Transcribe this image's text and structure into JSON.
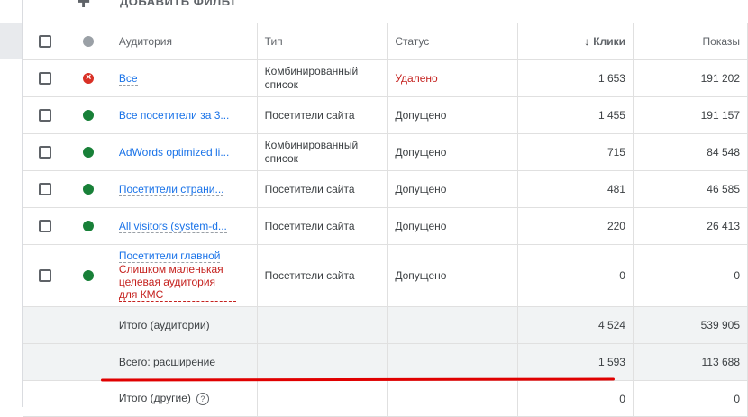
{
  "toolbar": {
    "add_icon": "plus-icon",
    "add_label": "ДОБАВИТЬ ФИЛЬТ"
  },
  "table": {
    "headers": {
      "audience": "Аудитория",
      "type": "Тип",
      "status": "Статус",
      "clicks": "Клики",
      "impressions": "Показы"
    },
    "rows": [
      {
        "status_dot": "red",
        "audience": "Все",
        "audience_note": "",
        "type": "Комбинированный список",
        "status": "Удалено",
        "clicks": "1 653",
        "impressions": "191 202"
      },
      {
        "status_dot": "green",
        "audience": "Все посетители за 3...",
        "audience_note": "",
        "type": "Посетители сайта",
        "status": "Допущено",
        "clicks": "1 455",
        "impressions": "191 157"
      },
      {
        "status_dot": "green",
        "audience": "AdWords optimized li...",
        "audience_note": "",
        "type": "Комбинированный список",
        "status": "Допущено",
        "clicks": "715",
        "impressions": "84 548"
      },
      {
        "status_dot": "green",
        "audience": "Посетители страни...",
        "audience_note": "",
        "type": "Посетители сайта",
        "status": "Допущено",
        "clicks": "481",
        "impressions": "46 585"
      },
      {
        "status_dot": "green",
        "audience": "All visitors (system-d...",
        "audience_note": "",
        "type": "Посетители сайта",
        "status": "Допущено",
        "clicks": "220",
        "impressions": "26 413"
      },
      {
        "status_dot": "green",
        "audience": "Посетители главной",
        "audience_note": "Слишком маленькая целевая аудитория для КМС",
        "type": "Посетители сайта",
        "status": "Допущено",
        "clicks": "0",
        "impressions": "0"
      }
    ],
    "summary": [
      {
        "label": "Итого (аудитории)",
        "clicks": "4 524",
        "impressions": "539 905"
      },
      {
        "label": "Всего: расширение",
        "clicks": "1 593",
        "impressions": "113 688"
      },
      {
        "label": "Итого (другие)",
        "clicks": "0",
        "impressions": "0"
      }
    ]
  },
  "colors": {
    "link": "#1a73e8",
    "removed": "#c5221f",
    "ok": "#188038",
    "annotation": "#e00000"
  }
}
